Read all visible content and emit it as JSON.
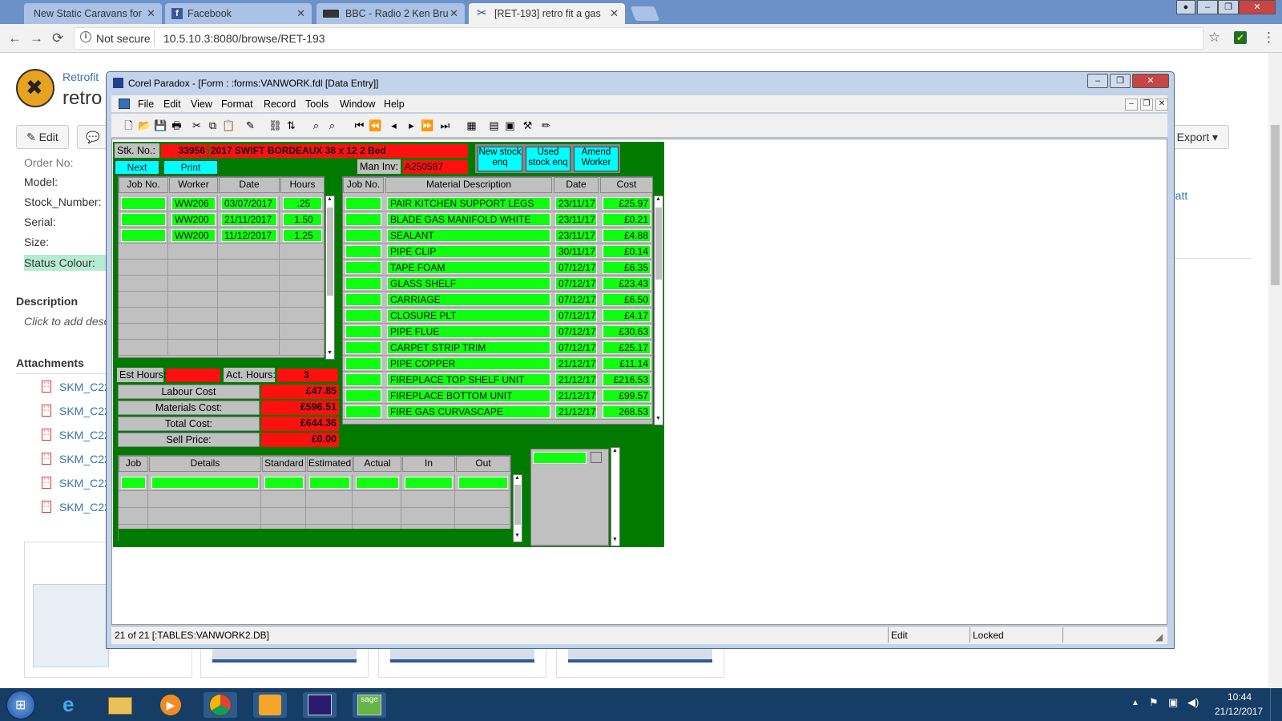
{
  "browser": {
    "tabs": [
      {
        "label": "New Static Caravans for"
      },
      {
        "label": "Facebook"
      },
      {
        "label": "BBC - Radio 2 Ken Bru"
      },
      {
        "label": "[RET-193] retro fit a gas"
      }
    ],
    "security": "Not secure",
    "url": "10.5.10.3:8080/browse/RET-193"
  },
  "jira": {
    "project": "Retrofit",
    "title": "retro",
    "edit_label": "Edit",
    "export_label": "Export",
    "fields": [
      "Order No:",
      "Model:",
      "Stock_Number:",
      "Serial:",
      "Size:",
      "Status Colour:"
    ],
    "description_heading": "Description",
    "description_placeholder": "Click to add desc",
    "attachments_heading": "Attachments",
    "attachments": [
      "SKM_C22",
      "SKM_C22",
      "SKM_C22",
      "SKM_C22",
      "SKM_C22",
      "SKM_C22"
    ],
    "right_text": "ratt"
  },
  "paradox": {
    "title": "Corel Paradox - [Form : :forms:VANWORK.fdl [Data Entry]]",
    "menu": [
      "File",
      "Edit",
      "View",
      "Format",
      "Record",
      "Tools",
      "Window",
      "Help"
    ],
    "status": {
      "record": "21 of 21 [:TABLES:VANWORK2.DB]",
      "mode": "Edit",
      "lock": "Locked"
    }
  },
  "form": {
    "stk_label": "Stk. No.:",
    "stk_no": "33956",
    "stk_desc": "2017 SWIFT BORDEAUX 38 x 12 2 Bed",
    "next_page": "Next Page",
    "print_record": "Print Record",
    "man_inv_label": "Man Inv:",
    "man_inv": "A250587",
    "buttons": [
      "New stock enq",
      "Used stock enq",
      "Amend Worker"
    ],
    "labour_headers": [
      "Job No.",
      "Worker",
      "Date",
      "Hours"
    ],
    "labour_rows": [
      {
        "job": "",
        "worker": "WW206",
        "date": "03/07/2017",
        "hours": ".25"
      },
      {
        "job": "",
        "worker": "WW200",
        "date": "21/11/2017",
        "hours": "1.50"
      },
      {
        "job": "",
        "worker": "WW200",
        "date": "11/12/2017",
        "hours": "1.25"
      }
    ],
    "material_headers": [
      "Job No.",
      "Material Description",
      "Date",
      "Cost"
    ],
    "material_rows": [
      {
        "desc": "PAIR KITCHEN SUPPORT LEGS",
        "date": "23/11/17",
        "cost": "£25.97"
      },
      {
        "desc": "BLADE GAS MANIFOLD WHITE",
        "date": "23/11/17",
        "cost": "£0.21"
      },
      {
        "desc": "SEALANT",
        "date": "23/11/17",
        "cost": "£4.88"
      },
      {
        "desc": "PIPE CLIP",
        "date": "30/11/17",
        "cost": "£0.14"
      },
      {
        "desc": "TAPE FOAM",
        "date": "07/12/17",
        "cost": "£6.35"
      },
      {
        "desc": "GLASS SHELF",
        "date": "07/12/17",
        "cost": "£23.43"
      },
      {
        "desc": "CARRIAGE",
        "date": "07/12/17",
        "cost": "£6.50"
      },
      {
        "desc": "CLOSURE PLT",
        "date": "07/12/17",
        "cost": "£4.17"
      },
      {
        "desc": "PIPE FLUE",
        "date": "07/12/17",
        "cost": "£30.63"
      },
      {
        "desc": "CARPET STRIP TRIM",
        "date": "07/12/17",
        "cost": "£25.17"
      },
      {
        "desc": "PIPE COPPER",
        "date": "21/12/17",
        "cost": "£11.14"
      },
      {
        "desc": "FIREPLACE TOP SHELF UNIT",
        "date": "21/12/17",
        "cost": "£216.53"
      },
      {
        "desc": "FIREPLACE BOTTOM UNIT",
        "date": "21/12/17",
        "cost": "£99.57"
      },
      {
        "desc": "FIRE GAS CURVASCAPE",
        "date": "21/12/17",
        "cost": "268.53"
      }
    ],
    "est_hours_label": "Est Hours:",
    "act_hours_label": "Act. Hours:",
    "act_hours": "3",
    "totals": [
      {
        "label": "Labour Cost",
        "value": "£47.85"
      },
      {
        "label": "Materials Cost:",
        "value": "£596.51"
      },
      {
        "label": "Total Cost:",
        "value": "£644.36"
      },
      {
        "label": "Sell Price:",
        "value": "£0.00"
      }
    ],
    "job_headers": [
      "Job",
      "Details",
      "Standard",
      "Estimated",
      "Actual",
      "In",
      "Out"
    ]
  },
  "clock": {
    "time": "10:44",
    "date": "21/12/2017"
  },
  "colors": {
    "form_bg": "#007a00",
    "field_green": "#10ff10",
    "field_red": "#ff1010",
    "button_cyan": "#00ffff"
  }
}
